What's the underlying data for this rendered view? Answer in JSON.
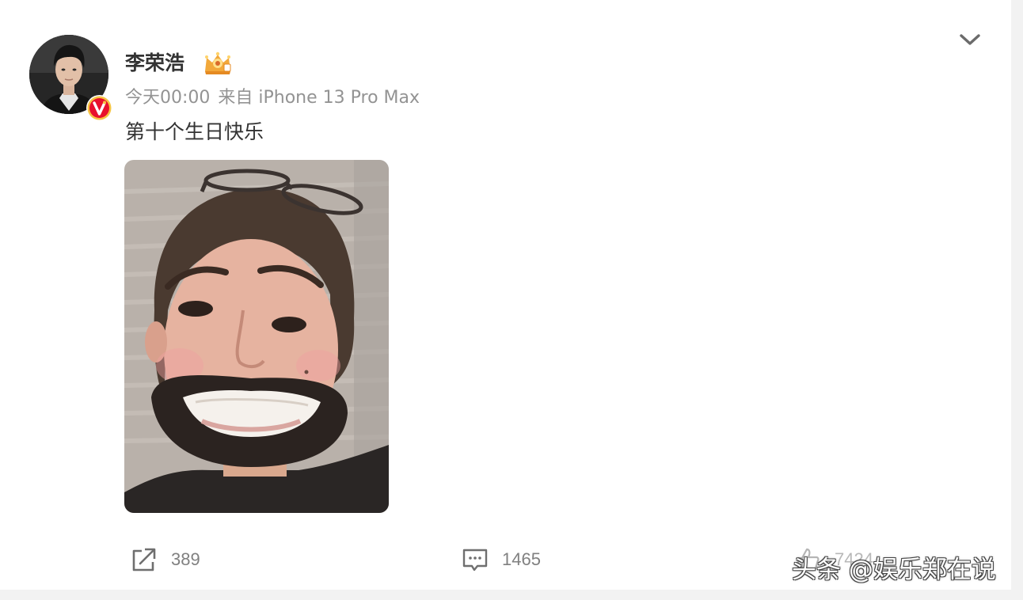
{
  "post": {
    "author": {
      "name": "李荣浩",
      "avatar_icon": "user-avatar",
      "verified_icon": "verified-v-badge",
      "rank_icon": "crown-rank-badge"
    },
    "time": "今天00:00",
    "source": "来自 iPhone 13 Pro Max",
    "text": "第十个生日快乐",
    "image_icon": "photo-thumbnail",
    "menu_icon": "chevron-down-icon"
  },
  "actions": {
    "repost": {
      "icon": "repost-icon",
      "count": "389"
    },
    "comment": {
      "icon": "comment-icon",
      "count": "1465"
    },
    "like": {
      "icon": "thumbs-up-icon",
      "count": "7424"
    }
  },
  "watermark": {
    "text": "头条 @娱乐郑在说"
  },
  "colors": {
    "primary_text": "#333333",
    "secondary_text": "#939393",
    "count_text": "#808080",
    "verified_badge": "#e8102c",
    "verified_ring": "#f6c343",
    "page_background": "#f2f2f2",
    "card_background": "#ffffff"
  }
}
